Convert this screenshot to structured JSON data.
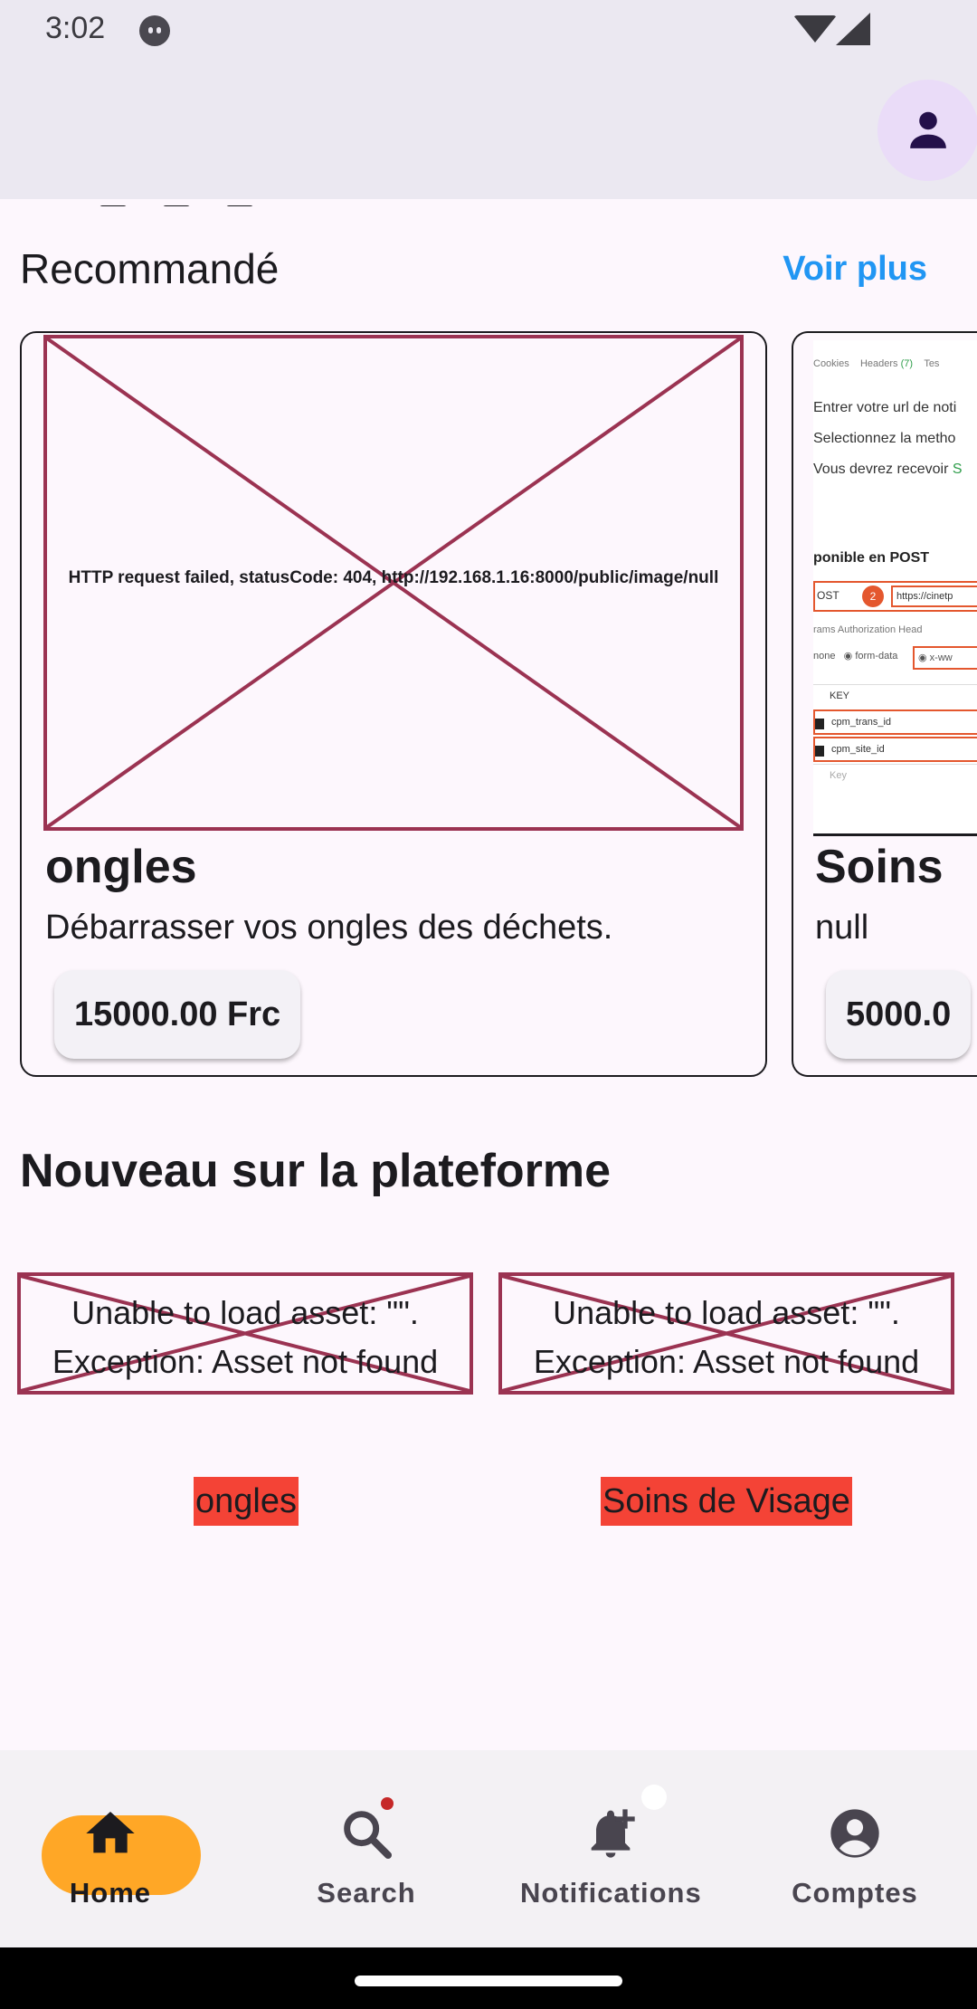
{
  "status_bar": {
    "time": "3:02"
  },
  "recommended": {
    "title": "Recommandé",
    "see_more": "Voir plus",
    "cards": [
      {
        "image_error": "HTTP request failed, statusCode: 404, http://192.168.1.16:8000/public/image/null",
        "title": "ongles",
        "description": "Débarrasser vos ongles des déchets.",
        "price": "15000.00 Frc"
      },
      {
        "title": "Soins",
        "description": "null",
        "price": "5000.0",
        "screenshot": {
          "tabs": "Cookies   Headers (7)   Tes",
          "tabs_parts": [
            "Cookies",
            "Headers ",
            "(7)",
            "Tes"
          ],
          "lines": [
            "Entrer votre url de noti",
            "Selectionnez la metho",
            "Vous devrez recevoir "
          ],
          "lines_accent": "S",
          "heading": "ponible en POST",
          "method": "OST",
          "badge": "2",
          "url": "https://cinetp",
          "sub_tabs": "rams    Authorization    Head",
          "body_opts": [
            "none",
            "form-data",
            "x-ww"
          ],
          "kv_rows": [
            "KEY",
            "cpm_trans_id",
            "cpm_site_id",
            "Key"
          ]
        }
      }
    ]
  },
  "nouveau": {
    "title": "Nouveau sur la plateforme",
    "items": [
      {
        "asset_error": "Unable to load asset: \"\".\nException: Asset not found",
        "label": "ongles"
      },
      {
        "asset_error": "Unable to load asset: \"\".\nException: Asset not found",
        "label": "Soins de Visage"
      }
    ]
  },
  "bottom_nav": {
    "items": [
      {
        "label": "Home",
        "icon": "home-icon",
        "active": true
      },
      {
        "label": "Search",
        "icon": "search-icon"
      },
      {
        "label": "Notifications",
        "icon": "notification-add-icon"
      },
      {
        "label": "Comptes",
        "icon": "account-circle-icon"
      }
    ]
  },
  "colors": {
    "accent_link": "#2196f3",
    "active_nav": "#ffa726",
    "error_border": "#9b3352",
    "label_bg": "#f44336",
    "avatar_bg": "#eadcf8"
  }
}
